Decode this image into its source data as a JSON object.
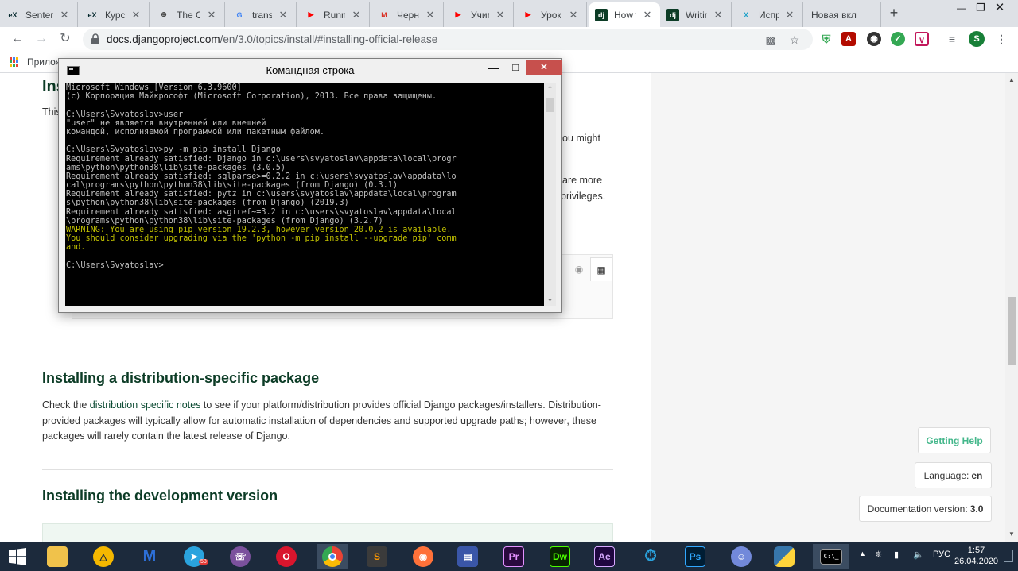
{
  "browser": {
    "tabs": [
      {
        "label": "Senter",
        "icon": "edx-icon",
        "color": "#02262b",
        "text": "eX"
      },
      {
        "label": "Курс |",
        "icon": "edx-icon",
        "color": "#02262b",
        "text": "eX"
      },
      {
        "label": "The Of",
        "icon": "globe-icon",
        "color": "#444444",
        "text": "⊕"
      },
      {
        "label": "transla",
        "icon": "google-icon",
        "color": "#4285f4",
        "text": "G"
      },
      {
        "label": "Runny",
        "icon": "youtube-icon",
        "color": "#ff0000",
        "text": "▶"
      },
      {
        "label": "Черно",
        "icon": "gmail-icon",
        "color": "#d93025",
        "text": "M"
      },
      {
        "label": "Учим",
        "icon": "youtube-icon",
        "color": "#ff0000",
        "text": "▶"
      },
      {
        "label": "Урок",
        "icon": "youtube-icon",
        "color": "#ff0000",
        "text": "▶"
      },
      {
        "label": "How t",
        "icon": "django-icon",
        "color": "#0c3c26",
        "text": "dj",
        "active": true
      },
      {
        "label": "Writin",
        "icon": "django-icon",
        "color": "#0c3c26",
        "text": "dj"
      },
      {
        "label": "Испра",
        "icon": "x-icon",
        "color": "#1aa0c8",
        "text": "X"
      },
      {
        "label": "Новая вкл",
        "icon": "",
        "color": "",
        "text": ""
      }
    ],
    "url_host": "docs.djangoproject.com",
    "url_path": "/en/3.0/topics/install/#installing-official-release",
    "bookmarks_label": "Прилож"
  },
  "page": {
    "partial_heading": "Inst",
    "partial_text_1": "This",
    "partial_text_2": "ou might",
    "partial_text_3": "are more",
    "partial_text_4": "privileges.",
    "section1_title": "Installing a distribution-specific package",
    "section1_p_before": "Check the ",
    "section1_link": "distribution specific notes",
    "section1_p_after": " to see if your platform/distribution provides official Django packages/installers. Distribution-provided packages will typically allow for automatic installation of dependencies and supported upgrade paths; however, these packages will rarely contain the latest release of Django.",
    "section2_title": "Installing the development version",
    "sidebar": {
      "help_label": "Getting Help",
      "language_label": "Language:",
      "language_value": "en",
      "version_label": "Documentation version:",
      "version_value": "3.0"
    }
  },
  "cmd": {
    "title": "Командная строка",
    "lines": [
      {
        "t": "Microsoft Windows [Version 6.3.9600]"
      },
      {
        "t": "(c) Корпорация Майкрософт (Microsoft Corporation), 2013. Все права защищены."
      },
      {
        "t": ""
      },
      {
        "t": "C:\\Users\\Svyatoslav>user"
      },
      {
        "t": "\"user\" не является внутренней или внешней"
      },
      {
        "t": "командой, исполняемой программой или пакетным файлом."
      },
      {
        "t": ""
      },
      {
        "t": "C:\\Users\\Svyatoslav>py -m pip install Django"
      },
      {
        "t": "Requirement already satisfied: Django in c:\\users\\svyatoslav\\appdata\\local\\progr"
      },
      {
        "t": "ams\\python\\python38\\lib\\site-packages (3.0.5)"
      },
      {
        "t": "Requirement already satisfied: sqlparse>=0.2.2 in c:\\users\\svyatoslav\\appdata\\lo"
      },
      {
        "t": "cal\\programs\\python\\python38\\lib\\site-packages (from Django) (0.3.1)"
      },
      {
        "t": "Requirement already satisfied: pytz in c:\\users\\svyatoslav\\appdata\\local\\program"
      },
      {
        "t": "s\\python\\python38\\lib\\site-packages (from Django) (2019.3)"
      },
      {
        "t": "Requirement already satisfied: asgiref~=3.2 in c:\\users\\svyatoslav\\appdata\\local"
      },
      {
        "t": "\\programs\\python\\python38\\lib\\site-packages (from Django) (3.2.7)"
      },
      {
        "t": "WARNING: You are using pip version 19.2.3, however version 20.0.2 is available.",
        "warn": true
      },
      {
        "t": "You should consider upgrading via the 'python -m pip install --upgrade pip' comm",
        "warn": true
      },
      {
        "t": "and.",
        "warn": true
      },
      {
        "t": ""
      },
      {
        "t": "C:\\Users\\Svyatoslav>"
      }
    ]
  },
  "taskbar": {
    "language": "РУС",
    "time": "1:57",
    "date": "26.04.2020",
    "telegram_badge": "58"
  },
  "colors": {
    "django_green": "#0c3c26",
    "accent_green": "#44b78b",
    "warning_yellow": "#c0c000"
  }
}
